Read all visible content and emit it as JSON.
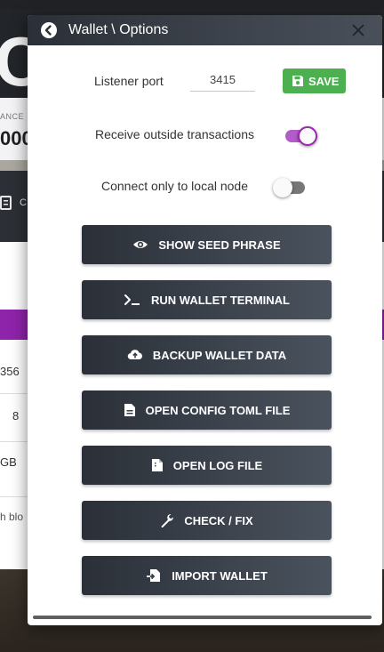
{
  "background": {
    "logo_text": "C",
    "balance_label": "ANCE",
    "balance_value": "000",
    "toolbar_text": "C",
    "rows": [
      "356",
      "8",
      "GB"
    ],
    "footer_text": "h blo"
  },
  "modal": {
    "title": "Wallet \\ Options",
    "listener_port_label": "Listener port",
    "listener_port_value": "3415",
    "save_label": "SAVE",
    "receive_outside_label": "Receive outside transactions",
    "receive_outside_enabled": true,
    "local_node_label": "Connect only to local node",
    "local_node_enabled": false,
    "actions": [
      {
        "label": "SHOW SEED PHRASE",
        "icon": "eye-icon"
      },
      {
        "label": "RUN WALLET TERMINAL",
        "icon": "terminal-icon"
      },
      {
        "label": "BACKUP WALLET DATA",
        "icon": "cloud-upload-icon"
      },
      {
        "label": "OPEN CONFIG TOML FILE",
        "icon": "file-text-icon"
      },
      {
        "label": "OPEN LOG FILE",
        "icon": "file-icon"
      },
      {
        "label": "CHECK / FIX",
        "icon": "wrench-icon"
      },
      {
        "label": "IMPORT WALLET",
        "icon": "file-import-icon"
      }
    ]
  },
  "colors": {
    "save_green": "#4caf50",
    "toggle_purple": "#9c27b0",
    "dark_button": "#2b3038"
  }
}
